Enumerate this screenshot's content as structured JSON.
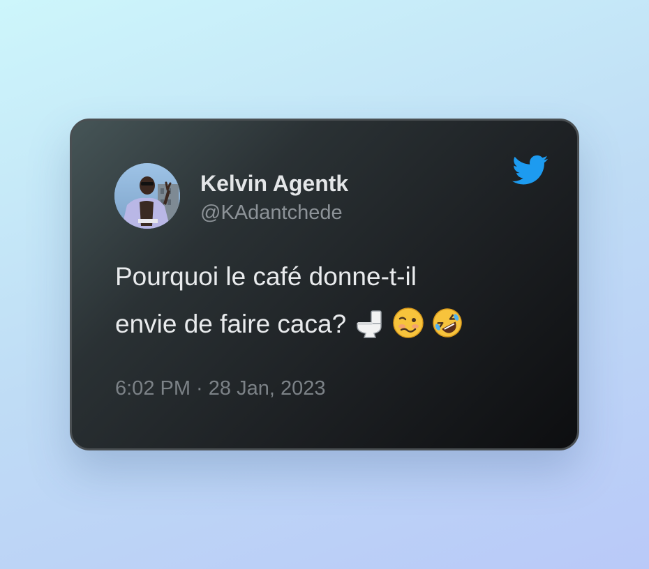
{
  "author": {
    "name": "Kelvin Agentk",
    "handle": "@KAdantchede"
  },
  "tweet": {
    "line1": "Pourquoi le café donne-t-il",
    "line2": "envie de faire caca?",
    "emojis": [
      "toilet-emoji",
      "woozy-face-emoji",
      "rolling-on-floor-laughing-emoji"
    ]
  },
  "timestamp": "6:02 PM · 28 Jan, 2023",
  "colors": {
    "twitter_blue": "#1d9bf0",
    "card_border": "#4a4f52"
  },
  "icons": {
    "brand": "twitter-bird-icon",
    "avatar": "avatar"
  }
}
